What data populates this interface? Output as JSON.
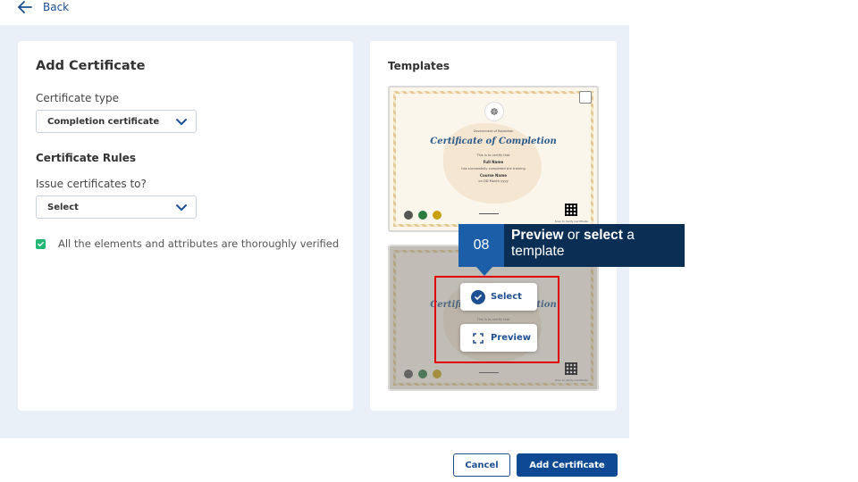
{
  "nav": {
    "back_label": "Back"
  },
  "form": {
    "title": "Add Certificate",
    "certificate_type_label": "Certificate type",
    "certificate_type_value": "Completion certificate",
    "rules_title": "Certificate Rules",
    "issue_to_label": "Issue certificates to?",
    "issue_to_value": "Select",
    "verify_checkbox_label": "All the elements and attributes are thoroughly verified",
    "verify_checked": true
  },
  "templates": {
    "title": "Templates",
    "items": [
      {
        "gov_text": "Government of Rajasthan",
        "cert_title": "Certificate of Completion",
        "line1": "This is to certify that",
        "name": "Full Name",
        "line2": "has successfully completed the training",
        "course": "Course Name",
        "date": "on DD Month yyyy",
        "scan_text": "Scan to Verify Certificate"
      },
      {
        "cert_title": "Certificate of Completion",
        "line1": "This is to certify that",
        "scan_text": "Scan to Verify Certificate"
      }
    ],
    "select_label": "Select",
    "preview_label": "Preview"
  },
  "callout": {
    "step": "08",
    "bold1": "Preview",
    "mid": " or ",
    "bold2": "select",
    "rest": " a template"
  },
  "footer": {
    "cancel_label": "Cancel",
    "add_label": "Add Certificate"
  },
  "colors": {
    "brand": "#0d4a93",
    "callout_bg": "#0b2e55",
    "callout_num_bg": "#1d5ea8",
    "highlight": "#e00000",
    "check": "#22b573"
  }
}
